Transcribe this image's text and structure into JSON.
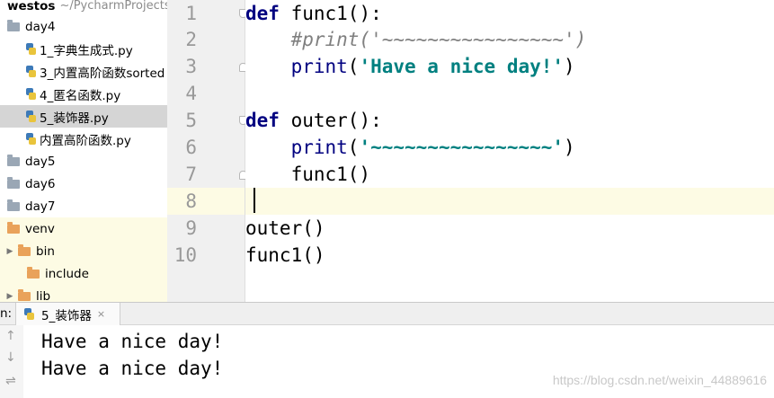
{
  "project": {
    "name": "westos",
    "path": "~/PycharmProjects"
  },
  "tree": {
    "day4": "day4",
    "files": [
      "1_字典生成式.py",
      "3_内置高阶函数sorted",
      "4_匿名函数.py",
      "5_装饰器.py",
      "内置高阶函数.py"
    ],
    "day5": "day5",
    "day6": "day6",
    "day7": "day7",
    "venv": "venv",
    "bin": "bin",
    "include": "include",
    "lib": "lib"
  },
  "editor": {
    "line_numbers": [
      "1",
      "2",
      "3",
      "4",
      "5",
      "6",
      "7",
      "8",
      "9",
      "10"
    ],
    "code": {
      "l1_kw": "def",
      "l1_rest": " func1():",
      "l2_comment": "#print('~~~~~~~~~~~~~~~~')",
      "l3_fn": "print",
      "l3_open": "(",
      "l3_str": "'Have a nice day!'",
      "l3_close": ")",
      "l5_kw": "def",
      "l5_rest": " outer():",
      "l6_fn": "print",
      "l6_open": "(",
      "l6_str": "'~~~~~~~~~~~~~~~~'",
      "l6_close": ")",
      "l7": "func1()",
      "l9": "outer()",
      "l10": "func1()"
    }
  },
  "run": {
    "prefix": "n:",
    "tab_label": "5_装饰器",
    "close": "×",
    "output": [
      "Have a nice day!",
      "Have a nice day!"
    ],
    "tools": [
      "↑",
      "↓",
      "⇌"
    ]
  },
  "watermark": "https://blog.csdn.net/weixin_44889616",
  "colors": {
    "keyword": "#000080",
    "string": "#008080",
    "comment": "#808080",
    "caret_line": "#fdfbe4",
    "selection": "#d5d5d5"
  }
}
